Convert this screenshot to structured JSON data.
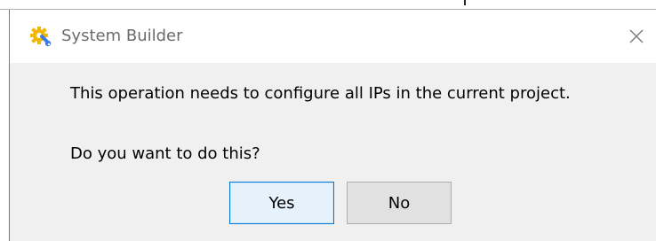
{
  "dialog": {
    "title": "System Builder",
    "app_icon": "system-builder-gear-wrench-icon",
    "close_icon": "close-icon",
    "message": "This operation needs to configure all IPs in the current project.",
    "question": "Do you want to do this?",
    "buttons": {
      "yes_label": "Yes",
      "no_label": "No"
    }
  },
  "colors": {
    "accent_blue": "#0078d7",
    "icon_yellow": "#f2b705",
    "icon_blue": "#3c7be0"
  }
}
